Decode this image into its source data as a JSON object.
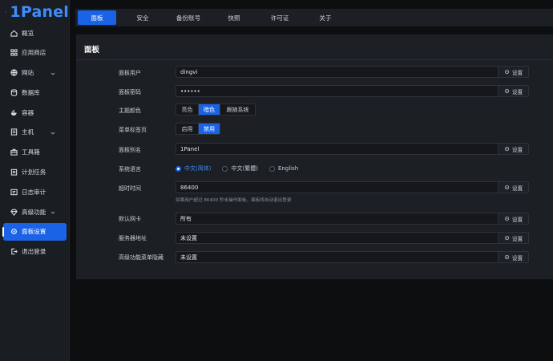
{
  "app": {
    "name": "1Panel"
  },
  "sidebar": {
    "items": [
      {
        "label": "概览",
        "icon": "home-icon",
        "expandable": false
      },
      {
        "label": "应用商店",
        "icon": "grid-icon",
        "expandable": false
      },
      {
        "label": "网站",
        "icon": "globe-icon",
        "expandable": true
      },
      {
        "label": "数据库",
        "icon": "database-icon",
        "expandable": false
      },
      {
        "label": "容器",
        "icon": "docker-icon",
        "expandable": false
      },
      {
        "label": "主机",
        "icon": "server-icon",
        "expandable": true
      },
      {
        "label": "工具箱",
        "icon": "toolbox-icon",
        "expandable": false
      },
      {
        "label": "计划任务",
        "icon": "clipboard-icon",
        "expandable": false
      },
      {
        "label": "日志审计",
        "icon": "log-icon",
        "expandable": false
      },
      {
        "label": "高级功能",
        "icon": "diamond-icon",
        "expandable": true
      },
      {
        "label": "面板设置",
        "icon": "gear-icon",
        "expandable": false,
        "active": true
      },
      {
        "label": "退出登录",
        "icon": "logout-icon",
        "expandable": false
      }
    ]
  },
  "tabs": [
    "面板",
    "安全",
    "备份账号",
    "快照",
    "许可证",
    "关于"
  ],
  "panel": {
    "title": "面板",
    "set_label": "设置",
    "rows": {
      "user": {
        "label": "面板用户",
        "value": "dingvi"
      },
      "password": {
        "label": "面板密码",
        "value": "••••••"
      },
      "theme": {
        "label": "主题颜色",
        "options": [
          "亮色",
          "暗色",
          "跟随系统"
        ],
        "selected": "暗色"
      },
      "menu_tab": {
        "label": "菜单标签页",
        "options": [
          "启用",
          "禁用"
        ],
        "selected": "禁用"
      },
      "alias": {
        "label": "面板别名",
        "value": "1Panel"
      },
      "language": {
        "label": "系统语言",
        "options": [
          "中文(简体)",
          "中文(繁體)",
          "English"
        ],
        "selected": "中文(简体)"
      },
      "timeout": {
        "label": "超时时间",
        "value": "86400",
        "hint": "如果用户超过 86400 秒未操作面板，面板将自动退出登录"
      },
      "nic": {
        "label": "默认网卡",
        "value": "所有"
      },
      "server_addr": {
        "label": "服务器地址",
        "value": "未设置"
      },
      "hidden_menu": {
        "label": "高级功能菜单隐藏",
        "value": "未设置"
      }
    }
  },
  "colors": {
    "accent": "#1a63e6",
    "logo": "#3f8cff",
    "bg": "#0d0e10",
    "panel": "#1c1f24"
  }
}
